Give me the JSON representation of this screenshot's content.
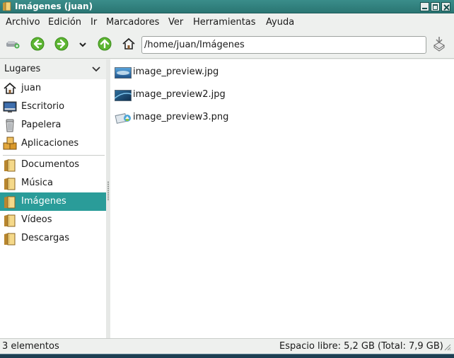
{
  "window": {
    "title": "Imágenes (juan)",
    "accent": "#2a9c99",
    "titlebar_color": "#2f807d"
  },
  "menubar": {
    "items": [
      "Archivo",
      "Edición",
      "Ir",
      "Marcadores",
      "Ver",
      "Herramientas",
      "Ayuda"
    ]
  },
  "toolbar": {
    "icons": [
      "new-tab-icon",
      "back-icon",
      "forward-icon",
      "history-dropdown-icon",
      "up-icon",
      "home-icon",
      "bookmark-icon"
    ],
    "path": "/home/juan/Imágenes"
  },
  "sidepane": {
    "header": "Lugares",
    "places": [
      {
        "label": "juan",
        "icon": "home-icon"
      },
      {
        "label": "Escritorio",
        "icon": "desktop-icon"
      },
      {
        "label": "Papelera",
        "icon": "trash-icon"
      },
      {
        "label": "Aplicaciones",
        "icon": "applications-icon"
      }
    ],
    "bookmarks": [
      {
        "label": "Documentos",
        "icon": "folder-icon"
      },
      {
        "label": "Música",
        "icon": "folder-icon"
      },
      {
        "label": "Imágenes",
        "icon": "folder-icon",
        "selected": true
      },
      {
        "label": "Vídeos",
        "icon": "folder-icon"
      },
      {
        "label": "Descargas",
        "icon": "folder-icon"
      }
    ]
  },
  "files": [
    {
      "name": "image_preview.jpg",
      "icon": "image-thumbnail-icon"
    },
    {
      "name": "image_preview2.jpg",
      "icon": "image-thumbnail-icon"
    },
    {
      "name": "image_preview3.png",
      "icon": "image-thumbnail-icon"
    }
  ],
  "statusbar": {
    "count": "3 elementos",
    "free_space": "Espacio libre: 5,2 GB (Total: 7,9 GB)"
  }
}
